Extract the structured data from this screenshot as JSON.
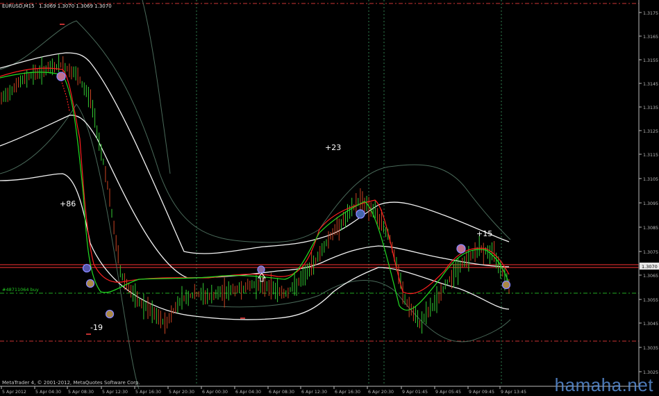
{
  "header": {
    "symbol": "EURUSD,M15",
    "ohlc": "1.3069 1.3070 1.3069 1.3070"
  },
  "copyright": "MetaTrader 4, © 2001-2012, MetaQuotes Software Corp.",
  "watermark": "hamaha.net",
  "order_label": "#48711064 buy",
  "current_price": "1.3070",
  "annotations": [
    "+86",
    "-19",
    "+23",
    "+15"
  ],
  "colors": {
    "background": "#000000",
    "bull_bar": "#33cc33",
    "bear_bar": "#cc4422",
    "bands": "#ffffff",
    "ma_red": "#ff2020",
    "ma_green": "#22dd22",
    "price_line": "#ff3333",
    "order_line": "#22aa22",
    "level_line": "#cc3333",
    "grid": "#2f6f3f",
    "axis_text": "#bbbbbb",
    "marker": "#7777ff"
  },
  "chart_data": {
    "type": "line",
    "title": "EURUSD,M15",
    "ylim": [
      1.3025,
      1.318
    ],
    "y_ticks": [
      "1.3175",
      "1.3165",
      "1.3155",
      "1.3145",
      "1.3135",
      "1.3125",
      "1.3115",
      "1.3105",
      "1.3095",
      "1.3085",
      "1.3075",
      "1.3070",
      "1.3065",
      "1.3055",
      "1.3045",
      "1.3035",
      "1.3025"
    ],
    "x_ticks": [
      "5 Apr 2012",
      "5 Apr 04:30",
      "5 Apr 08:30",
      "5 Apr 12:30",
      "5 Apr 16:30",
      "5 Apr 20:30",
      "6 Apr 00:30",
      "6 Apr 04:30",
      "6 Apr 08:30",
      "6 Apr 12:30",
      "6 Apr 16:30",
      "6 Apr 20:30",
      "9 Apr 01:45",
      "9 Apr 05:45",
      "9 Apr 09:45",
      "9 Apr 13:45"
    ],
    "series": [
      {
        "name": "",
        "values": [
          1.314,
          1.3146,
          1.315,
          1.3152,
          1.3154,
          1.315,
          1.314,
          1.311,
          1.307,
          1.306,
          1.3055,
          1.305,
          1.306,
          1.3062,
          1.3061,
          1.3063,
          1.3064,
          1.3066,
          1.3065,
          1.3062,
          1.3067,
          1.3075,
          1.3085,
          1.3092,
          1.31,
          1.3095,
          1.3085,
          1.306,
          1.305,
          1.3058,
          1.3068,
          1.3075,
          1.308,
          1.3078,
          1.3066
        ]
      }
    ],
    "levels": {
      "price": 1.307,
      "order": 1.306,
      "upper": 1.3177,
      "lower": 1.3038
    },
    "grid": true
  }
}
